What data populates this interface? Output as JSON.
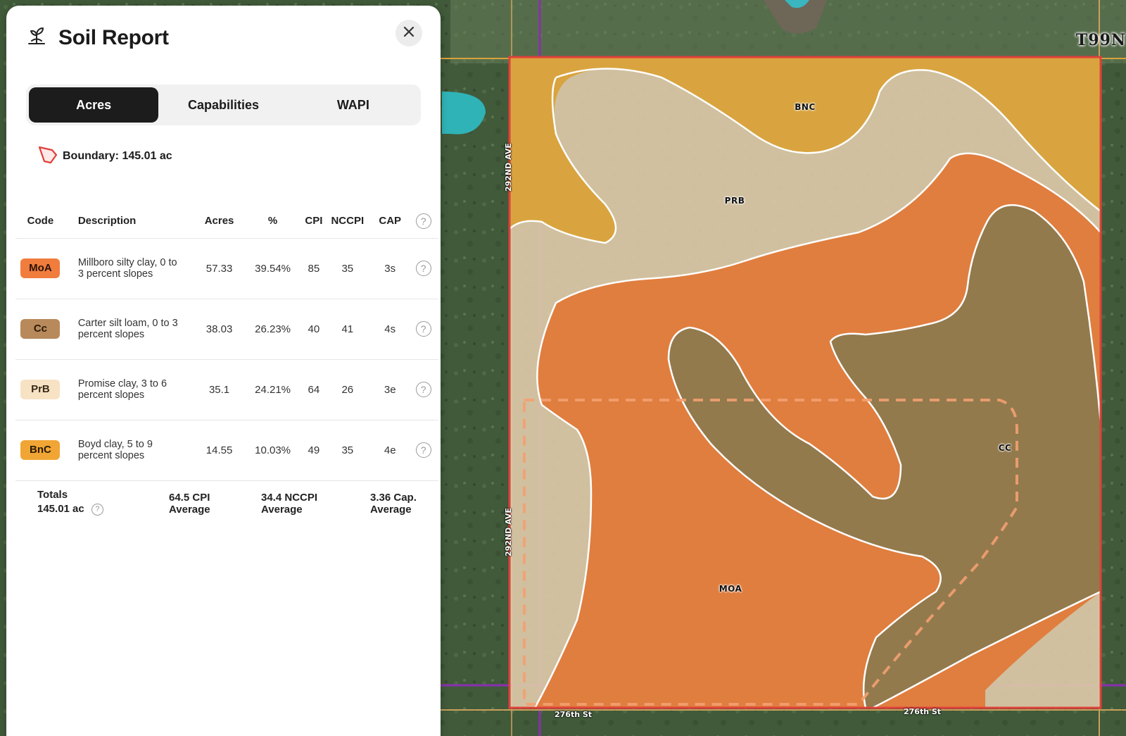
{
  "panel": {
    "title": "Soil Report",
    "title_icon": "seedling-icon",
    "close_icon": "close-icon"
  },
  "tabs": [
    {
      "label": "Acres",
      "active": true
    },
    {
      "label": "Capabilities",
      "active": false
    },
    {
      "label": "WAPI",
      "active": false
    }
  ],
  "boundary": {
    "label": "Boundary: 145.01 ac",
    "icon": "polygon-boundary-icon",
    "color": "#e0403a"
  },
  "table": {
    "headers": [
      "Code",
      "Description",
      "Acres",
      "%",
      "CPI",
      "NCCPI",
      "CAP"
    ],
    "rows": [
      {
        "code": "MoA",
        "desc1": "Millboro silty clay, 0 to",
        "desc2": "3 percent slopes",
        "acres": "57.33",
        "pct": "39.54%",
        "cpi": "85",
        "nccpi": "35",
        "cap": "3s",
        "badge_bg": "#f07c3d",
        "badge_fg": "#2a1306"
      },
      {
        "code": "Cc",
        "desc1": "Carter silt loam, 0 to 3",
        "desc2": "percent slopes",
        "acres": "38.03",
        "pct": "26.23%",
        "cpi": "40",
        "nccpi": "41",
        "cap": "4s",
        "badge_bg": "#b8895a",
        "badge_fg": "#2a1a0b"
      },
      {
        "code": "PrB",
        "desc1": "Promise clay, 3 to 6",
        "desc2": "percent slopes",
        "acres": "35.1",
        "pct": "24.21%",
        "cpi": "64",
        "nccpi": "26",
        "cap": "3e",
        "badge_bg": "#f7e2c4",
        "badge_fg": "#3a2a18"
      },
      {
        "code": "BnC",
        "desc1": "Boyd clay, 5 to 9",
        "desc2": "percent slopes",
        "acres": "14.55",
        "pct": "10.03%",
        "cpi": "49",
        "nccpi": "35",
        "cap": "4e",
        "badge_bg": "#f0a534",
        "badge_fg": "#2a1a05"
      }
    ]
  },
  "totals": {
    "label": "Totals",
    "acres": "145.01 ac",
    "cpi1": "64.5 CPI",
    "cpi2": "Average",
    "nccpi1": "34.4 NCCPI",
    "nccpi2": "Average",
    "cap1": "3.36 Cap.",
    "cap2": "Average"
  },
  "map": {
    "township": "T99N",
    "zones": [
      "BNC",
      "PRB",
      "CC",
      "MOA"
    ],
    "road_bottom_left": "276th St",
    "road_bottom_right": "276th St",
    "road_vertical_1": "292ND AVE",
    "road_vertical_2": "292ND AVE",
    "zone_colors": {
      "BNC": "#d9a23a",
      "PRB": "#dcc9a8",
      "CC": "#8d7a4e",
      "MOA": "#e07a3a"
    }
  }
}
